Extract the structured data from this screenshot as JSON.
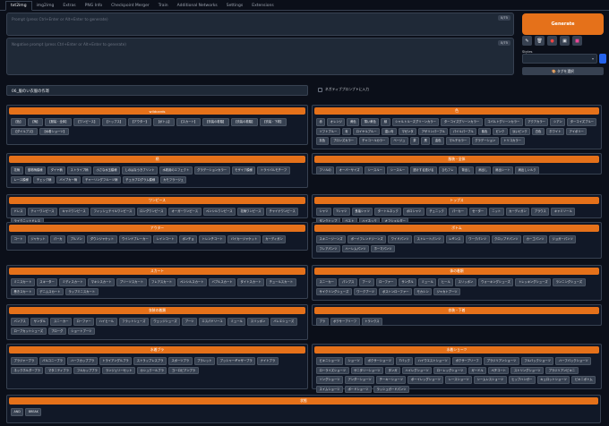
{
  "tabs": [
    "txt2img",
    "img2img",
    "Extras",
    "PNG Info",
    "Checkpoint Merger",
    "Train",
    "Additional Networks",
    "Settings",
    "Extensions"
  ],
  "prompt": {
    "placeholder": "Prompt (press Ctrl+Enter or Alt+Enter to generate)",
    "counter": "0/75"
  },
  "negative_prompt": {
    "placeholder": "Negative prompt (press Ctrl+Enter or Alt+Enter to generate)",
    "counter": "0/75"
  },
  "generate_label": "Generate",
  "tools": [
    "✎",
    "🗑",
    "●",
    "▣",
    "■"
  ],
  "styles_label": "Styles",
  "tag_button": "🎨 タグを選択",
  "category_select": "06_服のい衣服の作寄",
  "checkbox_label": "ネガティブプロンプトに入力",
  "sections": [
    {
      "title": "wildcards",
      "chips": [
        "【色】",
        "【柄】",
        "【服装・全体】",
        "【ワンピース】",
        "【トップス】",
        "【アウター】",
        "【ボトム】",
        "【スカート】",
        "【衣装の着類】",
        "【衣装の着類】",
        "【衣装・下着】",
        "【ダイルブス】",
        "【水着ショーツ】"
      ]
    },
    {
      "title": "色",
      "chips": [
        "赤",
        "オレンジ",
        "黄色",
        "薄い黄色",
        "緑",
        "シャルトルーズグリーンカラー",
        "ターコイズグリーンカラー",
        "コバルトグリーンカラー",
        "アクアカラー",
        "シアン",
        "ターコイズブルー",
        "ソフトブルー",
        "青",
        "ロイヤルブルー",
        "濃い青",
        "マゼンタ",
        "アザリンパープル",
        "パイルパープル",
        "紫色",
        "ピンク",
        "淡いピンク",
        "白色",
        "ホワイト",
        "アイボリー",
        "灰色",
        "ブロンズカラー",
        "チャコールカラー",
        "ベージュ",
        "茶",
        "黒",
        "金色",
        "マルチカラー",
        "グラデーション",
        "トリコカラー"
      ]
    },
    {
      "title": "柄",
      "chips": [
        "花柄",
        "動物柄模様",
        "ダイヤ柄",
        "ストライプ柄",
        "小さな水玉模様",
        "しのはなうきプリント",
        "水着用のエフェクト",
        "グラデーションカラー",
        "モザイク模様",
        "トライバルモチーフ",
        "レース模様",
        "チェック柄",
        "バイブカー柄",
        "チャーリングフルーツ柄",
        "チェカプログラム模様",
        "カモフラージュ"
      ]
    },
    {
      "title": "服装・全体",
      "chips": [
        "フリルの",
        "オーバーサイズ",
        "シースルー",
        "シースルー",
        "透けする透ける",
        "ひもフレ",
        "背出し",
        "肩出し",
        "肩出シート",
        "肩出しシルク"
      ]
    },
    {
      "title": "ワンピース",
      "chips": [
        "ドレス",
        "ティーワンピース",
        "キャミワンピース",
        "フィッシュテイルワンピース",
        "ロングワンピース",
        "オーガーワンピース",
        "ペンシルワンピース",
        "花柄ワンピース",
        "チャイナワンピース",
        "ライクニットドレス"
      ]
    },
    {
      "title": "トップス",
      "chips": [
        "シャツ",
        "Tシャツ",
        "長袖シャツ",
        "タートルネック",
        "ポロシャツ",
        "チュニック",
        "パーカー",
        "セーター",
        "ニット",
        "カーディガン",
        "ブラウス",
        "キャミソール",
        "タンクトップ",
        "ベスト",
        "ハイネック",
        "オフショルダー"
      ]
    },
    {
      "title": "アウター",
      "chips": [
        "コート",
        "ジャケット",
        "パーカ",
        "ブルゾン",
        "ダウンジャケット",
        "ウインドブレーカー",
        "レインコート",
        "ポンチョ",
        "トレンチコート",
        "バイカージャケット",
        "カーディガン"
      ]
    },
    {
      "title": "ボトム",
      "chips": [
        "スキニージーンズ",
        "ボーイフレンドジーンズ",
        "ワイドパンツ",
        "ストレートパンツ",
        "レギンス",
        "ワークパンツ",
        "クロップドパンツ",
        "カーゴパンツ",
        "ジョガーパンツ",
        "フレアパンツ",
        "ハーレムパンツ",
        "ホーマパンツ"
      ]
    },
    {
      "title": "スカート",
      "chips": [
        "ミニスカート",
        "スキーター",
        "ミディスカート",
        "マキシスカート",
        "プリーツスカート",
        "フレアスカート",
        "ペンシルスカート",
        "バブルスカート",
        "タイトスカート",
        "チュールスカート",
        "巻きスカート",
        "デニムスカート",
        "ラップミニスカート"
      ]
    },
    {
      "title": "体の着類",
      "chips": [
        "スニーカー",
        "パンプス",
        "ブーツ",
        "ローファー",
        "サンダル",
        "ミュール",
        "ヒール",
        "スリッポン",
        "ウォーキングシューズ",
        "トレッキングシューズ",
        "ランニングシューズ",
        "サイクリングシューズ",
        "ワークブーツ",
        "ボストンローファー",
        "モカシン",
        "ジャカトブーツ"
      ]
    },
    {
      "title": "衣装の着類",
      "chips": [
        "バンプス",
        "サンダル",
        "スニーカー",
        "ローファー",
        "ハイヒール",
        "フラットシューズ",
        "ウェッジシューズ",
        "ブーツ",
        "エスパドリーユ",
        "ミュール",
        "スリッポン",
        "バレエシューズ",
        "ロープカットシューズ",
        "ブローグ",
        "ショートブーツ"
      ]
    },
    {
      "title": "衣装・下着",
      "chips": [
        "ブラ",
        "ボクサーブリーフ",
        "トランクス"
      ]
    },
    {
      "title": "水着ブラ",
      "chips": [
        "ブラジャーブラ",
        "バルコニーブラ",
        "ハーフカップブラ",
        "トライアングルブラ",
        "ストラップレスブラ",
        "スポーツブラ",
        "ブラレット",
        "プッシャーギャザーブラ",
        "ナイトブラ",
        "ネックホルダーブラ",
        "マタニティブラ",
        "フルカップブラ",
        "ランジェリーセット",
        "カシュクールブラ",
        "ヨーロビアンブラ"
      ]
    },
    {
      "title": "水着ショーツ",
      "chips": [
        "ビキニショーツ",
        "ショーツ",
        "ボクサーショーツ",
        "Tバック",
        "ハイウエストショーツ",
        "ボクサーブリーフ",
        "ブラジリアンショーツ",
        "フルバックショーツ",
        "ハーフバックショーツ",
        "ローライズショーツ",
        "サニタリーショーツ",
        "タンガ",
        "ハイレグショーツ",
        "ローレッグショーツ",
        "ガードル",
        "ペチコート",
        "ストリングショーツ",
        "ブラジリアンビキニ",
        "ソングショーツ",
        "アンダーショーツ",
        "チーキーショーツ",
        "ボーイレッグショーツ",
        "レースショーツ",
        "シームレスショーツ",
        "ヒップハンガー",
        "キュロットショーツ",
        "ビキニボトム",
        "スイムショーツ",
        "ボードショーツ",
        "ラッシュガードパンツ"
      ]
    },
    {
      "title": "状態",
      "chips": [
        "AND",
        "BREAK"
      ]
    }
  ]
}
